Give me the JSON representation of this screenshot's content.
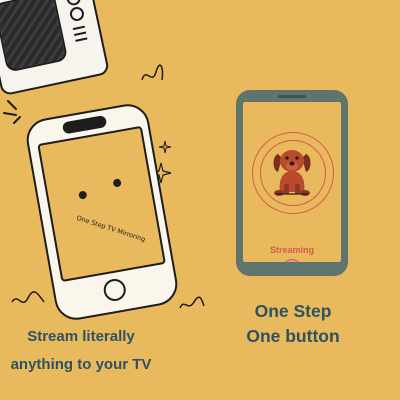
{
  "phone_doodle": {
    "screen_text": "One Step TV Mirroring"
  },
  "phone_right": {
    "status_label": "Streaming",
    "stop_icon": "stop-icon",
    "mascot_icon": "dog-icon"
  },
  "headline": {
    "line1": "One Step",
    "line2": "One button"
  },
  "caption": {
    "line1": "Stream literally",
    "line2": "anything to your TV"
  },
  "colors": {
    "background": "#E9B95E",
    "phone_frame": "#5E746C",
    "accent_red": "#D85A4A",
    "text_teal": "#2E5260"
  }
}
